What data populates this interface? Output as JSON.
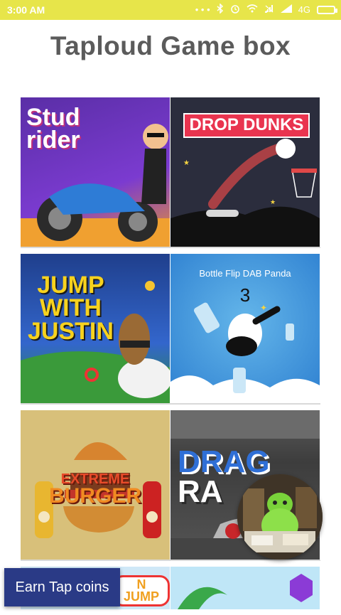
{
  "status_bar": {
    "time": "3:00 AM",
    "network": "4G",
    "dots": "• • •"
  },
  "header": {
    "title": "Taploud Game box"
  },
  "games": [
    {
      "title_line1": "Stud",
      "title_line2": "rider"
    },
    {
      "title": "DROP DUNKS"
    },
    {
      "title_line1": "JUMP",
      "title_line2": "WITH",
      "title_line3": "JUSTIN"
    },
    {
      "title": "Bottle Flip DAB Panda",
      "count": "3"
    },
    {
      "title_line1": "EXTREME",
      "title_line2": "BURGER"
    },
    {
      "title_line1": "DRAG",
      "title_line2": "RA"
    },
    {
      "title": "N JUMP"
    },
    {
      "title": ""
    }
  ],
  "earn_button": {
    "label": "Earn Tap coins"
  },
  "colors": {
    "status_bar": "#e7e54a",
    "title": "#5b5b5b",
    "earn_button": "#2a3a86"
  }
}
